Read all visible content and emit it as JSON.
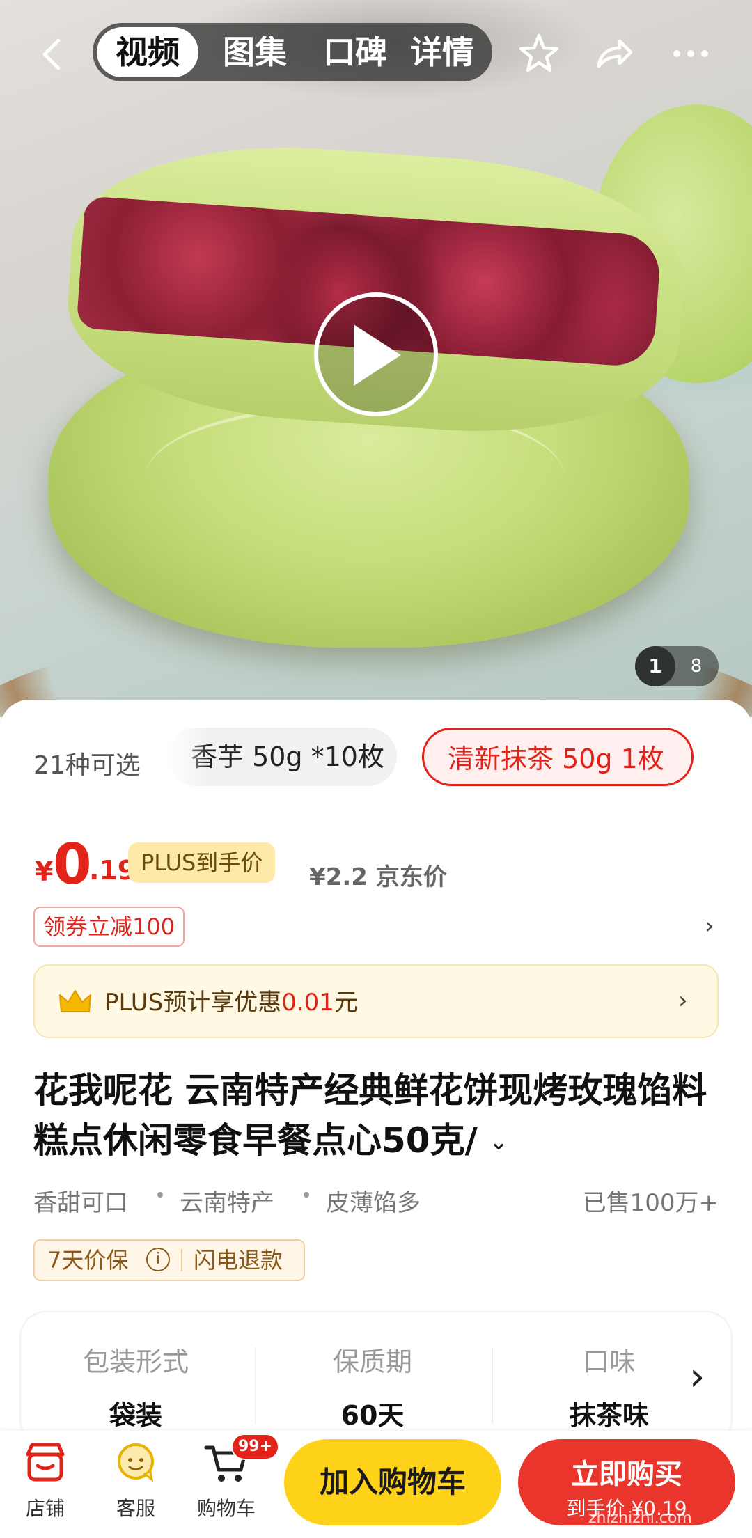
{
  "topbar": {
    "tabs": [
      "视频",
      "图集",
      "口碑",
      "详情"
    ],
    "active_tab": "视频"
  },
  "gallery": {
    "current": "1",
    "total": "8"
  },
  "sku": {
    "count_label": "21种可选",
    "options": [
      "香芋 50g *10枚",
      "清新抹茶 50g 1枚"
    ],
    "selected": "清新抹茶 50g 1枚"
  },
  "price": {
    "symbol": "¥",
    "integer": "0",
    "decimal": ".19",
    "plus_tag": "PLUS到手价",
    "jd_price": "¥2.2 京东价",
    "coupon": "领券立减100"
  },
  "plus_banner": {
    "prefix": "PLUS预计享优惠",
    "amount": "0.01",
    "suffix": "元"
  },
  "product": {
    "title": "花我呢花 云南特产经典鲜花饼现烤玫瑰馅料糕点休闲零食早餐点心50克/",
    "features": [
      "香甜可口",
      "云南特产",
      "皮薄馅多"
    ],
    "sold": "已售100万+",
    "guarantee": "7天价保",
    "guarantee_2": "闪电退款"
  },
  "specs": [
    {
      "label": "包装形式",
      "value": "袋装"
    },
    {
      "label": "保质期",
      "value": "60天"
    },
    {
      "label": "口味",
      "value": "抹茶味"
    }
  ],
  "bottom": {
    "store": "店铺",
    "service": "客服",
    "cart": "购物车",
    "cart_badge": "99+",
    "add_to_cart": "加入购物车",
    "buy_now": "立即购买",
    "buy_now_sub": "到手价 ¥0.19"
  },
  "watermark": "zhizhizhi.com",
  "colors": {
    "accent": "#e2231a",
    "cart_button": "#ffd21a",
    "buy_button": "#e9352c",
    "plus_tag": "#fde9a8"
  }
}
